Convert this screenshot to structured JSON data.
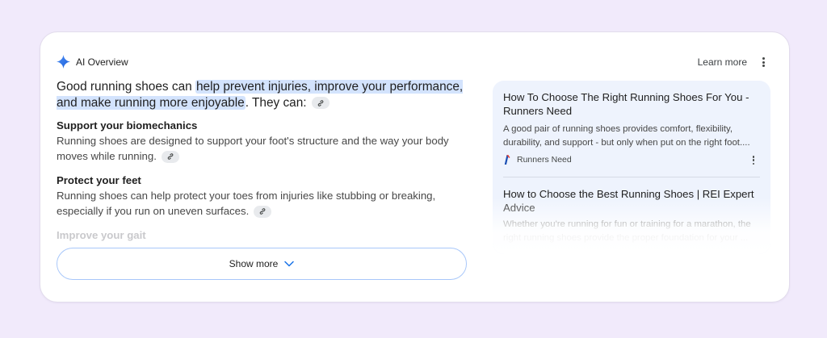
{
  "header": {
    "title": "AI Overview",
    "learn_more": "Learn more",
    "sparkle_color": "#1a73e8",
    "icons": {
      "sparkle": "sparkle-icon",
      "more": "more-vert-icon"
    }
  },
  "overview": {
    "lead_before": "Good running shoes can ",
    "lead_highlight": "help prevent injuries, improve your performance, and make running more enjoyable",
    "lead_after": ". They can:",
    "highlight_color": "#d3e3fd",
    "sections": [
      {
        "heading": "Support your biomechanics",
        "body": "Running shoes are designed to support your foot's structure and the way your body moves while running."
      },
      {
        "heading": "Protect your feet",
        "body": "Running shoes can help protect your toes from injuries like stubbing or breaking, especially if you run on uneven surfaces."
      }
    ],
    "faded_heading": "Improve your gait",
    "link_icon": "link-icon"
  },
  "show_more": {
    "label": "Show more",
    "icon": "chevron-down-icon"
  },
  "sources": [
    {
      "title": "How To Choose The Right Running Shoes For You - Runners Need",
      "snippet": "A good pair of running shoes provides comfort, flexibility, durability, and support - but only when put on the right foot....",
      "site": "Runners Need",
      "favicon": "runners-need-favicon"
    },
    {
      "title": "How to Choose the Best Running Shoes | REI Expert Advice",
      "snippet": "Whether you're running for fun or training for a marathon, the right running shoes provide the proper foundation for your ..."
    }
  ],
  "colors": {
    "page_bg": "#f1eafb",
    "panel_bg": "#eef3fd",
    "button_border": "#a8c7fa"
  }
}
